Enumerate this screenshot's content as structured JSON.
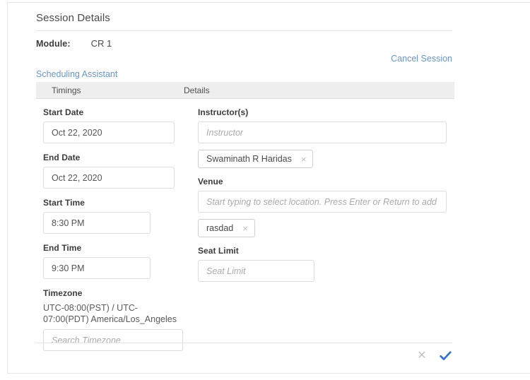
{
  "panel": {
    "title": "Session Details"
  },
  "module": {
    "label": "Module:",
    "value": "CR 1"
  },
  "links": {
    "cancel_session": "Cancel Session",
    "scheduling_assistant": "Scheduling Assistant"
  },
  "table_header": {
    "timings": "Timings",
    "details": "Details"
  },
  "timings": {
    "start_date": {
      "label": "Start Date",
      "value": "Oct 22, 2020"
    },
    "end_date": {
      "label": "End Date",
      "value": "Oct 22, 2020"
    },
    "start_time": {
      "label": "Start Time",
      "value": "8:30 PM"
    },
    "end_time": {
      "label": "End Time",
      "value": "9:30 PM"
    },
    "timezone": {
      "label": "Timezone",
      "value": "UTC-08:00(PST) / UTC-07:00(PDT) America/Los_Angeles",
      "placeholder": "Search Timezone"
    }
  },
  "details": {
    "instructors": {
      "label": "Instructor(s)",
      "placeholder": "Instructor",
      "chips": [
        {
          "text": "Swaminath R Haridas",
          "remove": "×"
        }
      ]
    },
    "venue": {
      "label": "Venue",
      "placeholder": "Start typing to select location. Press Enter or Return to add r.",
      "chips": [
        {
          "text": "rasdad",
          "remove": "×"
        }
      ]
    },
    "seat_limit": {
      "label": "Seat Limit",
      "placeholder": "Seat Limit"
    }
  },
  "footer": {
    "cancel_glyph": "✕",
    "confirm_label": "Confirm"
  },
  "colors": {
    "link_blue": "#6b94cc",
    "confirm_blue": "#2f6fd0",
    "header_strip": "#eeeeee",
    "border_gray": "#dcdcdc",
    "text_dark": "#3c3c3c",
    "placeholder_gray": "#aaaaaa"
  }
}
